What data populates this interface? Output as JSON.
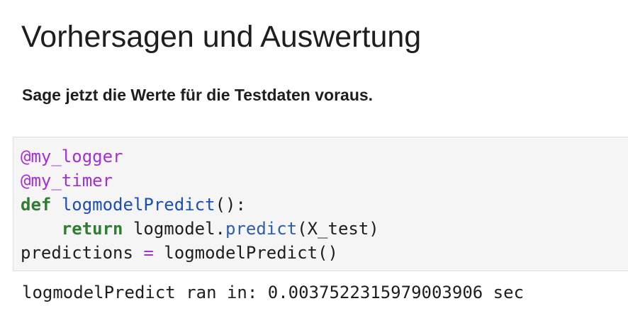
{
  "markdown": {
    "heading": "Vorhersagen und Auswertung",
    "subheading": "Sage jetzt die Werte für die Testdaten voraus."
  },
  "code_cell": {
    "line1": {
      "decorator": "@my_logger"
    },
    "line2": {
      "decorator": "@my_timer"
    },
    "line3": {
      "keyword": "def",
      "space": " ",
      "func_name": "logmodelPredict",
      "rest": "():"
    },
    "line4": {
      "indent": "    ",
      "keyword": "return",
      "space": " ",
      "object": "logmodel.",
      "method": "predict",
      "args": "(X_test)"
    },
    "line5": {
      "target": "predictions ",
      "operator": "=",
      "call": " logmodelPredict()"
    }
  },
  "output": {
    "text": "logmodelPredict ran in: 0.0037522315979003906 sec"
  },
  "colors": {
    "decorator": "#a62ed6",
    "keyword": "#2e7d32",
    "function_name": "#1a4dbf",
    "method": "#2f5ea8",
    "operator": "#a62ed6",
    "cell_background": "#f5f5f5"
  }
}
